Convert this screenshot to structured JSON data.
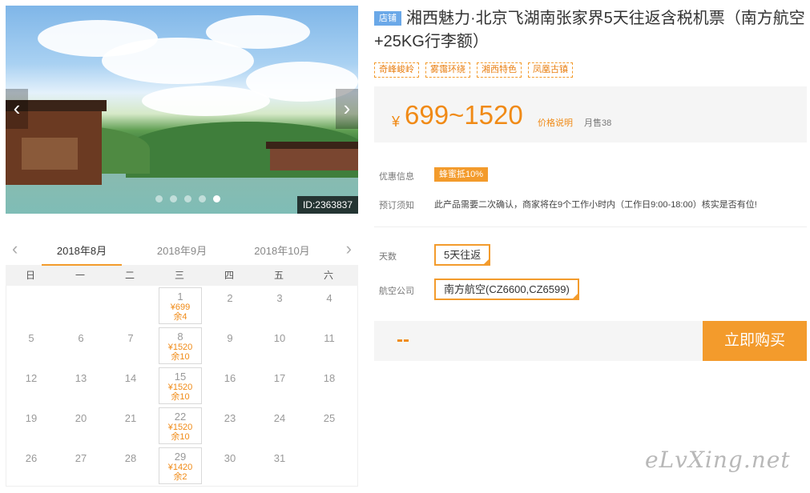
{
  "photo": {
    "id_label": "ID:2363837",
    "slides": 5,
    "active_slide": 4
  },
  "calendar": {
    "prev_icon": "chevron-left-icon",
    "next_icon": "chevron-right-icon",
    "months": [
      "2018年8月",
      "2018年9月",
      "2018年10月"
    ],
    "active_month": 0,
    "weekdays": [
      "日",
      "一",
      "二",
      "三",
      "四",
      "五",
      "六"
    ],
    "leading_blanks": 3,
    "days": [
      {
        "d": "1",
        "price": "¥699",
        "remain": "余4"
      },
      {
        "d": "2"
      },
      {
        "d": "3"
      },
      {
        "d": "4"
      },
      {
        "d": "5"
      },
      {
        "d": "6"
      },
      {
        "d": "7"
      },
      {
        "d": "8",
        "price": "¥1520",
        "remain": "余10"
      },
      {
        "d": "9"
      },
      {
        "d": "10"
      },
      {
        "d": "11"
      },
      {
        "d": "12"
      },
      {
        "d": "13"
      },
      {
        "d": "14"
      },
      {
        "d": "15",
        "price": "¥1520",
        "remain": "余10"
      },
      {
        "d": "16"
      },
      {
        "d": "17"
      },
      {
        "d": "18"
      },
      {
        "d": "19"
      },
      {
        "d": "20"
      },
      {
        "d": "21"
      },
      {
        "d": "22",
        "price": "¥1520",
        "remain": "余10"
      },
      {
        "d": "23"
      },
      {
        "d": "24"
      },
      {
        "d": "25"
      },
      {
        "d": "26"
      },
      {
        "d": "27"
      },
      {
        "d": "28"
      },
      {
        "d": "29",
        "price": "¥1420",
        "remain": "余2"
      },
      {
        "d": "30"
      },
      {
        "d": "31"
      }
    ]
  },
  "product": {
    "shop_tag": "店铺",
    "title": "湘西魅力·北京飞湖南张家界5天往返含税机票（南方航空+25KG行李额）",
    "tags": [
      "奇峰峻岭",
      "雾霭环绕",
      "湘西特色",
      "凤凰古镇"
    ],
    "currency": "¥",
    "price": "699~1520",
    "price_note": "价格说明",
    "sold": "月售38"
  },
  "info": {
    "promo_label": "优惠信息",
    "promo_badge": "蜂蜜抵10%",
    "notice_label": "预订须知",
    "notice_text": "此产品需要二次确认，商家将在9个工作小时内（工作日9:00-18:00）核实是否有位!"
  },
  "options": {
    "days_label": "天数",
    "days_value": "5天往返",
    "airline_label": "航空公司",
    "airline_value": "南方航空(CZ6600,CZ6599)"
  },
  "buy": {
    "total": "--",
    "button": "立即购买"
  },
  "watermark": "eLvXing.net",
  "colors": {
    "accent": "#f39b2c",
    "price": "#f08a16",
    "shop_tag": "#6aa8e8"
  }
}
